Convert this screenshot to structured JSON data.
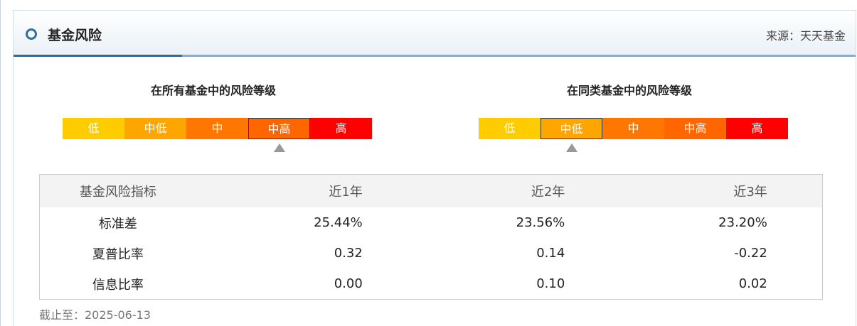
{
  "header": {
    "title": "基金风险",
    "source": "来源：天天基金"
  },
  "gauges": [
    {
      "title": "在所有基金中的风险等级",
      "levels": [
        "低",
        "中低",
        "中",
        "中高",
        "高"
      ],
      "colors": [
        "#ffcc00",
        "#ffa500",
        "#ff7700",
        "#ff6600",
        "#ff0000"
      ],
      "selected": "中高"
    },
    {
      "title": "在同类基金中的风险等级",
      "levels": [
        "低",
        "中低",
        "中",
        "中高",
        "高"
      ],
      "colors": [
        "#ffcc00",
        "#ffa500",
        "#ff7700",
        "#ff6600",
        "#ff0000"
      ],
      "selected": "中低"
    }
  ],
  "table": {
    "headers": [
      "基金风险指标",
      "近1年",
      "近2年",
      "近3年"
    ],
    "rows": [
      [
        "标准差",
        "25.44%",
        "23.56%",
        "23.20%"
      ],
      [
        "夏普比率",
        "0.32",
        "0.14",
        "-0.22"
      ],
      [
        "信息比率",
        "0.00",
        "0.10",
        "0.02"
      ]
    ]
  },
  "as_of": "截止至：2025-06-13"
}
